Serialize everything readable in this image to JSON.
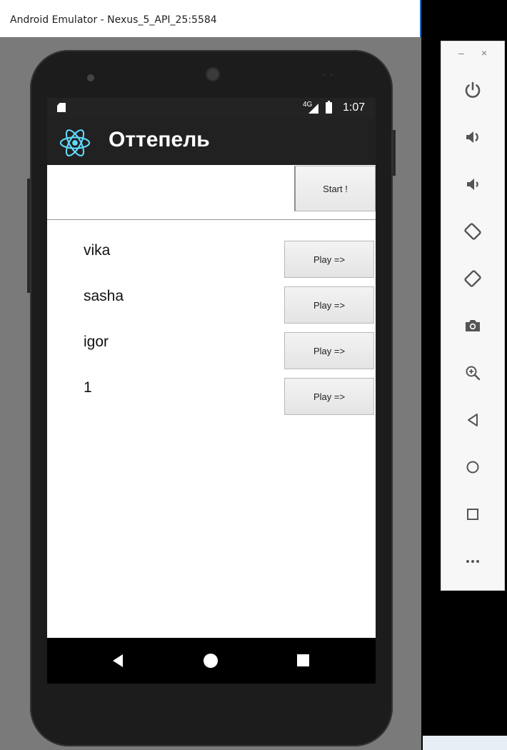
{
  "window": {
    "title": "Android Emulator - Nexus_5_API_25:5584"
  },
  "status_bar": {
    "network": "4G",
    "time": "1:07"
  },
  "app": {
    "title": "Оттепель",
    "start_label": "Start !"
  },
  "players": [
    {
      "name": "vika",
      "play_label": "Play =>"
    },
    {
      "name": "sasha",
      "play_label": "Play =>"
    },
    {
      "name": "igor",
      "play_label": "Play =>"
    },
    {
      "name": "1",
      "play_label": "Play =>"
    }
  ],
  "controls": {
    "minimize": "–",
    "close": "×",
    "items": [
      "power-icon",
      "volume-up-icon",
      "volume-down-icon",
      "rotate-left-icon",
      "rotate-right-icon",
      "camera-icon",
      "zoom-icon",
      "back-icon",
      "home-icon",
      "overview-icon",
      "more-icon"
    ]
  },
  "colors": {
    "accent": "#61dafb",
    "toolbar": "#212121",
    "panel": "#f7f7f7",
    "icon": "#555555"
  }
}
